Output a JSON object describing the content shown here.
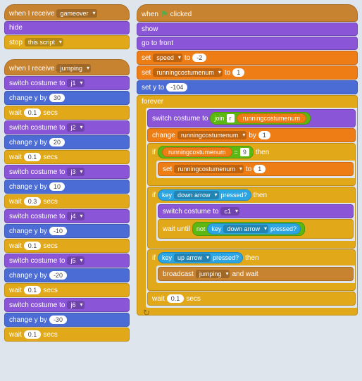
{
  "col1": {
    "s1": {
      "hat": {
        "label": "when I receive",
        "msg": "gameover"
      },
      "hide": "hide",
      "stop": {
        "label": "stop",
        "opt": "this script"
      }
    },
    "s2": {
      "hat": {
        "label": "when I receive",
        "msg": "jumping"
      },
      "rows": [
        {
          "sw": "switch costume to",
          "c": "j1",
          "ch": "change y by",
          "v": "30",
          "w": "wait",
          "s": "0.1",
          "sec": "secs"
        },
        {
          "sw": "switch costume to",
          "c": "j2",
          "ch": "change y by",
          "v": "20",
          "w": "wait",
          "s": "0.1",
          "sec": "secs"
        },
        {
          "sw": "switch costume to",
          "c": "j3",
          "ch": "change y by",
          "v": "10",
          "w": "wait",
          "s": "0.3",
          "sec": "secs"
        },
        {
          "sw": "switch costume to",
          "c": "j4",
          "ch": "change y by",
          "v": "-10",
          "w": "wait",
          "s": "0.1",
          "sec": "secs"
        },
        {
          "sw": "switch costume to",
          "c": "j5",
          "ch": "change y by",
          "v": "-20",
          "w": "wait",
          "s": "0.1",
          "sec": "secs"
        },
        {
          "sw": "switch costume to",
          "c": "j6",
          "ch": "change y by",
          "v": "-30",
          "w": "wait",
          "s": "0.1",
          "sec": "secs"
        }
      ]
    }
  },
  "col2": {
    "hat": {
      "label": "when",
      "clicked": "clicked"
    },
    "show": "show",
    "front": "go to front",
    "setspeed": {
      "set": "set",
      "var": "speed",
      "to": "to",
      "val": "-2"
    },
    "setrun": {
      "set": "set",
      "var": "runningcostumenum",
      "to": "to",
      "val": "1"
    },
    "sety": {
      "label": "set y to",
      "val": "-104"
    },
    "forever": "forever",
    "swcost": {
      "label": "switch costume to",
      "join": "join",
      "r": "r",
      "var": "runningcostumenum"
    },
    "change": {
      "label": "change",
      "var": "runningcostumenum",
      "by": "by",
      "val": "1"
    },
    "if1": {
      "if": "if",
      "var": "runningcostumenum",
      "eq": "=",
      "nine": "9",
      "then": "then"
    },
    "setrun2": {
      "set": "set",
      "var": "runningcostumenum",
      "to": "to",
      "val": "1"
    },
    "if2": {
      "if": "if",
      "key": "key",
      "arrow": "down arrow",
      "pressed": "pressed?",
      "then": "then"
    },
    "swc1": {
      "label": "switch costume to",
      "c": "c1"
    },
    "waituntil": {
      "label": "wait until",
      "not": "not",
      "key": "key",
      "arrow": "down arrow",
      "pressed": "pressed?"
    },
    "if3": {
      "if": "if",
      "key": "key",
      "arrow": "up arrow",
      "pressed": "pressed?",
      "then": "then"
    },
    "bcast": {
      "label": "broadcast",
      "msg": "jumping",
      "wait": "and wait"
    },
    "waitend": {
      "label": "wait",
      "val": "0.1",
      "sec": "secs"
    }
  }
}
